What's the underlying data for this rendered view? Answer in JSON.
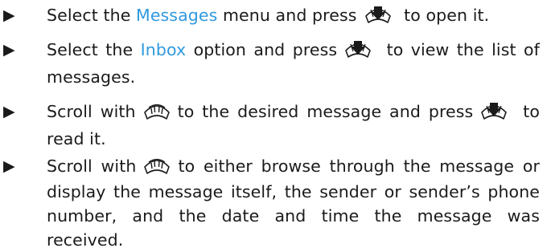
{
  "steps": [
    {
      "bullet": "▶",
      "lines": [
        {
          "pre": "Select the ",
          "link": "Messages",
          "mid": " menu and press",
          "key": "select-key-icon",
          "post": " to open it."
        }
      ]
    },
    {
      "bullet": "▶",
      "lines": [
        {
          "pre": "Select the ",
          "link": "Inbox",
          "mid": " option and press",
          "key": "select-key-icon",
          "post": " to view the list of"
        },
        {
          "text": "messages."
        }
      ]
    },
    {
      "bullet": "▶",
      "lines": [
        {
          "pre": "Scroll with",
          "key": "scroll-key-icon",
          "mid": "to the desired message and press",
          "key2": "select-key-icon",
          "post": " to"
        },
        {
          "text": "read it."
        }
      ]
    },
    {
      "bullet": "▶",
      "lines": [
        {
          "pre": "Scroll with",
          "key": "scroll-key-icon",
          "post": "to either browse through the message or"
        },
        {
          "text": "display the message itself, the sender or sender’s phone"
        },
        {
          "text": "number, and the date and time the message was received."
        }
      ]
    }
  ],
  "colors": {
    "link": "#2f9ae0",
    "text": "#1a1a1a",
    "icon": "#1a1a1a"
  }
}
